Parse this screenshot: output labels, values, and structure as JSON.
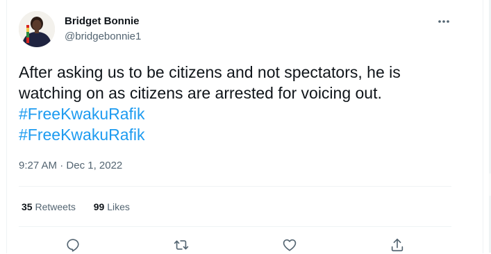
{
  "author": {
    "name": "Bridget Bonnie",
    "handle": "@bridgebonnie1"
  },
  "tweet": {
    "lines": [
      "After asking us to be citizens and not spectators, he is",
      "watching on as citizens are arrested for voicing out."
    ],
    "hashtags": [
      "#FreeKwakuRafik",
      "#FreeKwakuRafik"
    ]
  },
  "meta": {
    "time": "9:27 AM",
    "separator": "·",
    "date": "Dec 1, 2022"
  },
  "stats": {
    "retweets_count": "35",
    "retweets_label": "Retweets",
    "likes_count": "99",
    "likes_label": "Likes"
  },
  "icons": {
    "more": "more-icon",
    "reply": "reply-icon",
    "retweet": "retweet-icon",
    "like": "like-icon",
    "share": "share-icon"
  },
  "colors": {
    "hashtag": "#1d9bf0",
    "secondary_text": "#536471",
    "divider": "#eff3f4"
  }
}
